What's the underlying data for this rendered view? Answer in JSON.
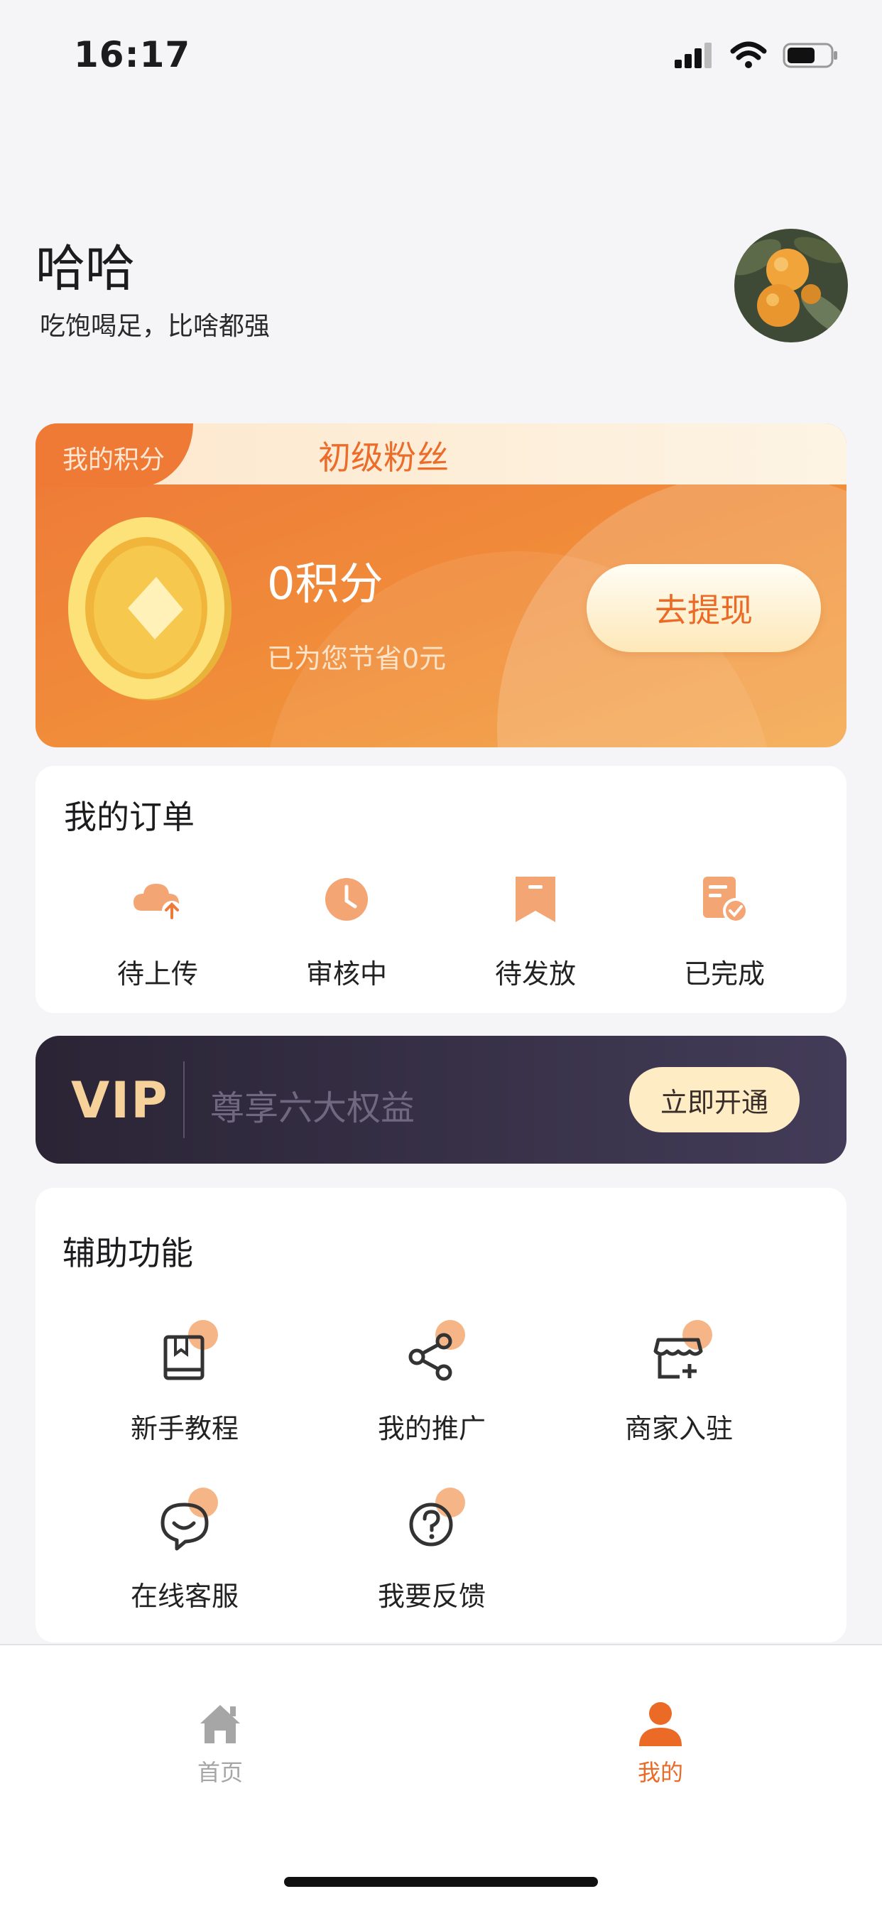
{
  "status_bar": {
    "time": "16:17"
  },
  "profile": {
    "name": "哈哈",
    "signature": "吃饱喝足，比啥都强"
  },
  "points_card": {
    "label": "我的积分",
    "level": "初级粉丝",
    "points": "0积分",
    "saved": "已为您节省0元",
    "withdraw_label": "去提现"
  },
  "orders": {
    "title": "我的订单",
    "items": [
      {
        "label": "待上传",
        "icon": "cloud-upload-icon"
      },
      {
        "label": "审核中",
        "icon": "clock-icon"
      },
      {
        "label": "待发放",
        "icon": "bookmark-icon"
      },
      {
        "label": "已完成",
        "icon": "checklist-icon"
      }
    ]
  },
  "vip": {
    "badge": "VIP",
    "benefits": "尊享六大权益",
    "open_label": "立即开通"
  },
  "aux": {
    "title": "辅助功能",
    "items": [
      {
        "label": "新手教程",
        "icon": "book-icon"
      },
      {
        "label": "我的推广",
        "icon": "share-icon"
      },
      {
        "label": "商家入驻",
        "icon": "store-icon"
      },
      {
        "label": "在线客服",
        "icon": "chat-smile-icon"
      },
      {
        "label": "我要反馈",
        "icon": "question-icon"
      }
    ]
  },
  "tab_bar": {
    "items": [
      {
        "label": "首页",
        "icon": "home-icon"
      },
      {
        "label": "我的",
        "icon": "person-icon"
      }
    ]
  },
  "colors": {
    "accent": "#ea6a26",
    "inactive_tab": "#a6a6a6",
    "vip_gold": "#f6d29a"
  }
}
